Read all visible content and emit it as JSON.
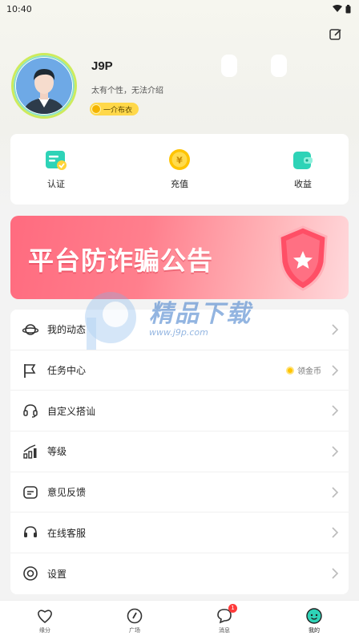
{
  "status": {
    "time": "10:40"
  },
  "profile": {
    "username": "J9P",
    "bio": "太有个性，无法介绍",
    "rank": "一介布衣"
  },
  "quick_actions": [
    {
      "label": "认证",
      "icon": "verify-icon"
    },
    {
      "label": "充值",
      "icon": "recharge-coin-icon"
    },
    {
      "label": "收益",
      "icon": "wallet-icon"
    }
  ],
  "banner": {
    "text": "平台防诈骗公告",
    "icon": "shield-star-icon"
  },
  "watermark": {
    "text": "精品下载",
    "url": "www.j9p.com"
  },
  "menu": [
    {
      "label": "我的动态",
      "icon": "planet-icon"
    },
    {
      "label": "任务中心",
      "icon": "flag-icon",
      "extra": "领金币"
    },
    {
      "label": "自定义搭讪",
      "icon": "headset-icon"
    },
    {
      "label": "等级",
      "icon": "level-bars-icon"
    },
    {
      "label": "意见反馈",
      "icon": "feedback-icon"
    },
    {
      "label": "在线客服",
      "icon": "headset-icon"
    },
    {
      "label": "设置",
      "icon": "settings-icon"
    }
  ],
  "tabs": [
    {
      "label": "缘分",
      "icon": "heart-icon"
    },
    {
      "label": "广场",
      "icon": "compass-icon"
    },
    {
      "label": "消息",
      "icon": "chat-bubble-icon",
      "badge": "1"
    },
    {
      "label": "我的",
      "icon": "smiley-icon"
    }
  ],
  "colors": {
    "accent": "#2ed3b7",
    "banner": "#ff6b7f",
    "coin": "#ffc400"
  }
}
